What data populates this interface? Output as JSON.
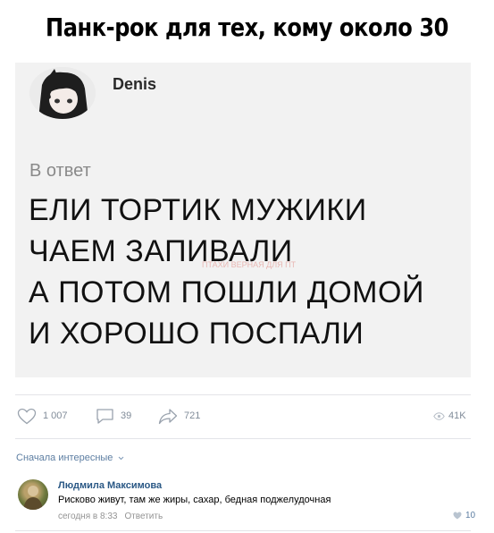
{
  "meme_title": "Панк-рок для тех, кому около 30",
  "post": {
    "author": "Denis",
    "reply_label": "В ответ",
    "lines": [
      "ЕЛИ ТОРТИК МУЖИКИ",
      "ЧАЕМ ЗАПИВАЛИ",
      "А ПОТОМ ПОШЛИ ДОМОЙ",
      "И ХОРОШО ПОСПАЛИ"
    ],
    "watermark": "ПТАХИ ВЕРНАЯ ДЛЯ ПТ"
  },
  "actions": {
    "likes": "1 007",
    "comments": "39",
    "shares": "721",
    "views": "41K"
  },
  "sort_label": "Сначала интересные",
  "comment": {
    "author": "Людмила Максимова",
    "text": "Рисково живут, там же жиры, сахар, бедная поджелудочная",
    "time": "сегодня в 8:33",
    "reply_label": "Ответить",
    "likes": "10"
  },
  "colors": {
    "card_bg": "#f2f2f2",
    "icon_gray": "#818c99",
    "link_blue": "#2a5885",
    "accent_blue": "#5d7ea2"
  }
}
